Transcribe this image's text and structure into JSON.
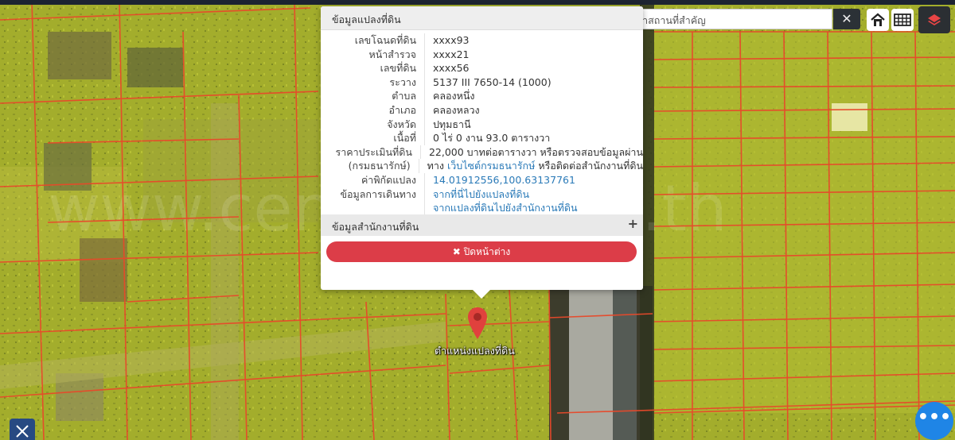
{
  "search": {
    "placeholder": "ค้นหาสถานที่สำคัญ",
    "clear_icon": "✕"
  },
  "toolbar": {
    "home_icon": "home-icon",
    "grid_icon": "grid-icon",
    "layers_icon": "layers-icon"
  },
  "popup": {
    "title": "ข้อมูลแปลงที่ดิน",
    "rows": [
      {
        "label": "เลขโฉนดที่ดิน",
        "value": "xxxx93"
      },
      {
        "label": "หน้าสำรวจ",
        "value": "xxxx21"
      },
      {
        "label": "เลขที่ดิน",
        "value": "xxxx56"
      },
      {
        "label": "ระวาง",
        "value": "5137 III 7650-14 (1000)"
      },
      {
        "label": "ตำบล",
        "value": "คลองหนึ่ง"
      },
      {
        "label": "อำเภอ",
        "value": "คลองหลวง"
      },
      {
        "label": "จังหวัด",
        "value": "ปทุมธานี"
      },
      {
        "label": "เนื้อที่",
        "value": "0 ไร่ 0 งาน 93.0 ตารางวา"
      }
    ],
    "price_label_1": "ราคาประเมินที่ดิน",
    "price_label_2": "(กรมธนารักษ์)",
    "price_value_1": "22,000 บาทต่อตารางวา หรือตรวจสอบข้อมูลผ่าน",
    "price_value_2_prefix": "ทาง",
    "price_value_2_link": "เว็บไซต์กรมธนารักษ์",
    "price_value_2_suffix": "หรือติดต่อสำนักงานที่ดิน",
    "coord_label": "ค่าพิกัดแปลง",
    "coord_value": "14.01912556,100.63137761",
    "travel_label": "ข้อมูลการเดินทาง",
    "travel_link_1": "จากที่นี่ไปยังแปลงที่ดิน",
    "travel_link_2": "จากแปลงที่ดินไปยังสำนักงานที่ดิน",
    "office_section": "ข้อมูลสำนักงานที่ดิน",
    "expand_icon": "+",
    "close_label": "ปิดหน้าต่าง",
    "close_icon": "✖"
  },
  "marker": {
    "label": "ตำแหน่งแปลงที่ดิน",
    "color": "#e0413d"
  },
  "watermark": "www.cenbaniho.co.th",
  "colors": {
    "parcel_line": "#e8492a",
    "overlay": "#d9e21c",
    "close_button": "#dc3d48",
    "fab": "#1f85e6"
  },
  "fab": {
    "icon": "more-icon",
    "glyph": "•••"
  },
  "tool": {
    "icon": "tools-icon"
  }
}
